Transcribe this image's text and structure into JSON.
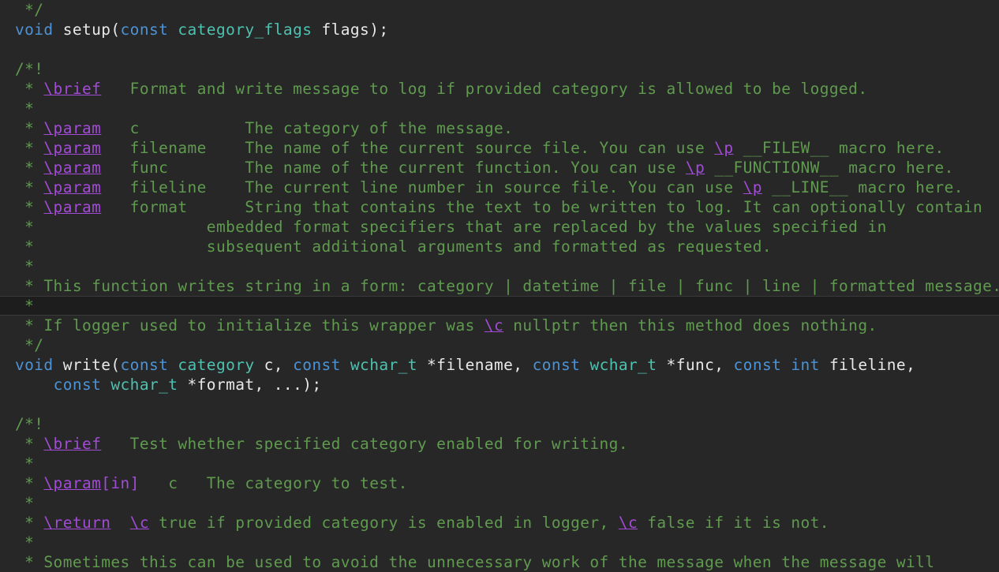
{
  "editor": {
    "background": "#272727",
    "colors": {
      "comment": "#5f9a4f",
      "keyword": "#4b93d6",
      "type": "#4ec1b0",
      "doc_tag": "#a24bd6",
      "identifier": "#e8e8e8"
    },
    "lines": [
      [
        {
          "t": " */",
          "c": "cm"
        }
      ],
      [
        {
          "t": "void",
          "c": "kw"
        },
        {
          "t": " setup(",
          "c": "plain"
        },
        {
          "t": "const",
          "c": "kw"
        },
        {
          "t": " ",
          "c": "plain"
        },
        {
          "t": "category_flags",
          "c": "ty"
        },
        {
          "t": " flags);",
          "c": "plain"
        }
      ],
      [],
      [
        {
          "t": "/*!",
          "c": "cm"
        }
      ],
      [
        {
          "t": " * ",
          "c": "cm"
        },
        {
          "t": "\\brief",
          "c": "tag"
        },
        {
          "t": "   Format and write message to log if provided category is allowed to be logged.",
          "c": "cm"
        }
      ],
      [
        {
          "t": " *",
          "c": "cm"
        }
      ],
      [
        {
          "t": " * ",
          "c": "cm"
        },
        {
          "t": "\\param",
          "c": "tag"
        },
        {
          "t": "   c           The category of the message.",
          "c": "cm"
        }
      ],
      [
        {
          "t": " * ",
          "c": "cm"
        },
        {
          "t": "\\param",
          "c": "tag"
        },
        {
          "t": "   filename    The name of the current source file. You can use ",
          "c": "cm"
        },
        {
          "t": "\\p",
          "c": "tag"
        },
        {
          "t": " __FILEW__ macro here.",
          "c": "cm"
        }
      ],
      [
        {
          "t": " * ",
          "c": "cm"
        },
        {
          "t": "\\param",
          "c": "tag"
        },
        {
          "t": "   func        The name of the current function. You can use ",
          "c": "cm"
        },
        {
          "t": "\\p",
          "c": "tag"
        },
        {
          "t": " __FUNCTIONW__ macro here.",
          "c": "cm"
        }
      ],
      [
        {
          "t": " * ",
          "c": "cm"
        },
        {
          "t": "\\param",
          "c": "tag"
        },
        {
          "t": "   fileline    The current line number in source file. You can use ",
          "c": "cm"
        },
        {
          "t": "\\p",
          "c": "tag"
        },
        {
          "t": " __LINE__ macro here.",
          "c": "cm"
        }
      ],
      [
        {
          "t": " * ",
          "c": "cm"
        },
        {
          "t": "\\param",
          "c": "tag"
        },
        {
          "t": "   format      String that contains the text to be written to log. It can optionally contain",
          "c": "cm"
        }
      ],
      [
        {
          "t": " *                  embedded format specifiers that are replaced by the values specified in",
          "c": "cm"
        }
      ],
      [
        {
          "t": " *                  subsequent additional arguments and formatted as requested.",
          "c": "cm"
        }
      ],
      [
        {
          "t": " *",
          "c": "cm"
        }
      ],
      [
        {
          "t": " * This function writes string in a form: category | datetime | file | func | line | formatted message.",
          "c": "cm"
        }
      ],
      [
        {
          "t": " *",
          "c": "cm"
        }
      ],
      [
        {
          "t": " * If logger used to initialize this wrapper was ",
          "c": "cm"
        },
        {
          "t": "\\c",
          "c": "tag"
        },
        {
          "t": " nullptr then this method does nothing.",
          "c": "cm"
        }
      ],
      [
        {
          "t": " */",
          "c": "cm"
        }
      ],
      [
        {
          "t": "void",
          "c": "kw"
        },
        {
          "t": " write(",
          "c": "plain"
        },
        {
          "t": "const",
          "c": "kw"
        },
        {
          "t": " ",
          "c": "plain"
        },
        {
          "t": "category",
          "c": "ty"
        },
        {
          "t": " c, ",
          "c": "plain"
        },
        {
          "t": "const",
          "c": "kw"
        },
        {
          "t": " ",
          "c": "plain"
        },
        {
          "t": "wchar_t",
          "c": "ty"
        },
        {
          "t": " *filename, ",
          "c": "plain"
        },
        {
          "t": "const",
          "c": "kw"
        },
        {
          "t": " ",
          "c": "plain"
        },
        {
          "t": "wchar_t",
          "c": "ty"
        },
        {
          "t": " *func, ",
          "c": "plain"
        },
        {
          "t": "const",
          "c": "kw"
        },
        {
          "t": " ",
          "c": "plain"
        },
        {
          "t": "int",
          "c": "kw"
        },
        {
          "t": " fileline,",
          "c": "plain"
        }
      ],
      [
        {
          "t": "    ",
          "c": "plain"
        },
        {
          "t": "const",
          "c": "kw"
        },
        {
          "t": " ",
          "c": "plain"
        },
        {
          "t": "wchar_t",
          "c": "ty"
        },
        {
          "t": " *format, ...);",
          "c": "plain"
        }
      ],
      [],
      [
        {
          "t": "/*!",
          "c": "cm"
        }
      ],
      [
        {
          "t": " * ",
          "c": "cm"
        },
        {
          "t": "\\brief",
          "c": "tag"
        },
        {
          "t": "   Test whether specified category enabled for writing.",
          "c": "cm"
        }
      ],
      [
        {
          "t": " *",
          "c": "cm"
        }
      ],
      [
        {
          "t": " * ",
          "c": "cm"
        },
        {
          "t": "\\param",
          "c": "tag"
        },
        {
          "t": "[in]",
          "c": "br"
        },
        {
          "t": "   c   The category to test.",
          "c": "cm"
        }
      ],
      [
        {
          "t": " *",
          "c": "cm"
        }
      ],
      [
        {
          "t": " * ",
          "c": "cm"
        },
        {
          "t": "\\return",
          "c": "tag"
        },
        {
          "t": "  ",
          "c": "cm"
        },
        {
          "t": "\\c",
          "c": "tag"
        },
        {
          "t": " true if provided category is enabled in logger, ",
          "c": "cm"
        },
        {
          "t": "\\c",
          "c": "tag"
        },
        {
          "t": " false if it is not.",
          "c": "cm"
        }
      ],
      [
        {
          "t": " *",
          "c": "cm"
        }
      ],
      [
        {
          "t": " * Sometimes this can be used to avoid the unnecessary work of the message when the message will",
          "c": "cm"
        }
      ]
    ],
    "current_line_index": 15
  }
}
